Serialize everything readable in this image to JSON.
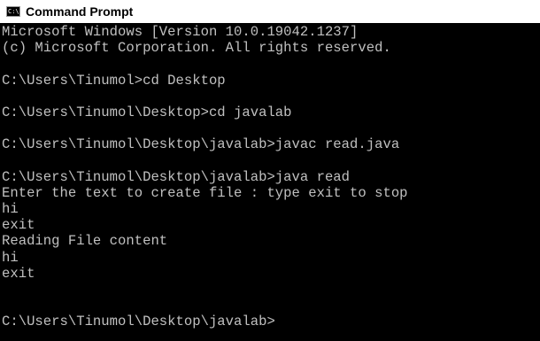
{
  "window": {
    "title": "Command Prompt",
    "icon": "cmd-app-icon",
    "icon_glyph": "C:\\.",
    "colors": {
      "background": "#000000",
      "text": "#c0c0c0",
      "titlebar": "#ffffff"
    }
  },
  "console": {
    "lines": [
      "Microsoft Windows [Version 10.0.19042.1237]",
      "(c) Microsoft Corporation. All rights reserved.",
      "",
      "C:\\Users\\Tinumol>cd Desktop",
      "",
      "C:\\Users\\Tinumol\\Desktop>cd javalab",
      "",
      "C:\\Users\\Tinumol\\Desktop\\javalab>javac read.java",
      "",
      "C:\\Users\\Tinumol\\Desktop\\javalab>java read",
      "Enter the text to create file : type exit to stop",
      "hi",
      "exit",
      "Reading File content",
      "hi",
      "exit",
      "",
      "",
      "C:\\Users\\Tinumol\\Desktop\\javalab>"
    ]
  }
}
